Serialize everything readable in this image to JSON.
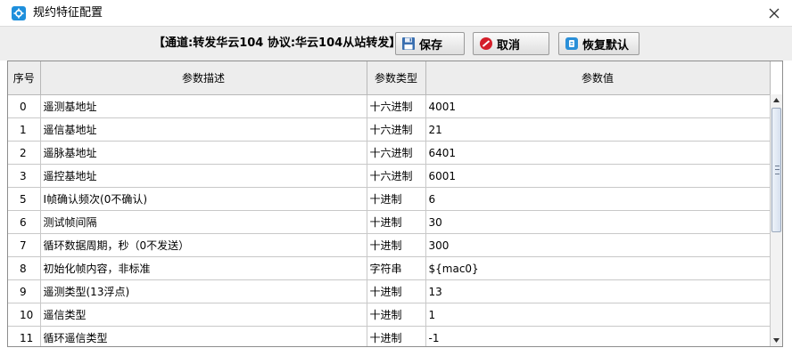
{
  "window": {
    "title": "规约特征配置"
  },
  "toolbar": {
    "channel_label": "【通道:转发华云104  协议:华云104从站转发】",
    "save_label": "保存",
    "cancel_label": "取消",
    "reset_label": "恢复默认"
  },
  "colors": {
    "save_icon": "#3a6fb0",
    "cancel_icon": "#d41f2a",
    "reset_icon": "#2a8fd8"
  },
  "table": {
    "headers": [
      "序号",
      "参数描述",
      "参数类型",
      "参数值"
    ],
    "rows": [
      [
        "0",
        "遥测基地址",
        "十六进制",
        "4001"
      ],
      [
        "1",
        "遥信基地址",
        "十六进制",
        "21"
      ],
      [
        "2",
        "遥脉基地址",
        "十六进制",
        "6401"
      ],
      [
        "3",
        "遥控基地址",
        "十六进制",
        "6001"
      ],
      [
        "5",
        "I帧确认频次(0不确认)",
        "十进制",
        "6"
      ],
      [
        "6",
        "测试帧间隔",
        "十进制",
        "30"
      ],
      [
        "7",
        "循环数据周期，秒（0不发送）",
        "十进制",
        "300"
      ],
      [
        "8",
        "初始化帧内容，非标准",
        "字符串",
        "${mac0}"
      ],
      [
        "9",
        "遥测类型(13浮点)",
        "十进制",
        "13"
      ],
      [
        "10",
        "遥信类型",
        "十进制",
        "1"
      ],
      [
        "11",
        "循环遥信类型",
        "十进制",
        "-1"
      ]
    ]
  }
}
